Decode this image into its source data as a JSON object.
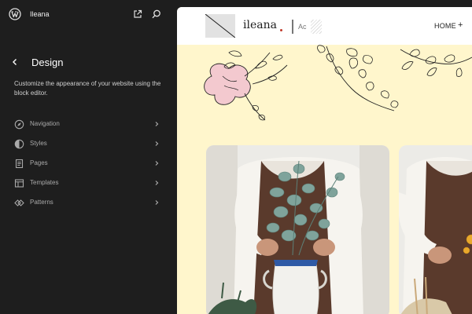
{
  "sidebar": {
    "site_name": "Ileana",
    "title": "Design",
    "description": "Customize the appearance of your website using the block editor.",
    "items": [
      {
        "label": "Navigation",
        "icon": "navigation-icon"
      },
      {
        "label": "Styles",
        "icon": "styles-icon"
      },
      {
        "label": "Pages",
        "icon": "pages-icon"
      },
      {
        "label": "Templates",
        "icon": "templates-icon"
      },
      {
        "label": "Patterns",
        "icon": "patterns-icon"
      }
    ]
  },
  "preview": {
    "brand": "ileana",
    "tagline": "Ac",
    "nav_home": "HOME",
    "nav_home_plus": "+",
    "background": "#fff6cc",
    "accent_dot": "#c0392b"
  },
  "colors": {
    "sidebar_bg": "#1e1e1e",
    "sidebar_text": "#a9a9a9",
    "title_text": "#ffffff"
  }
}
